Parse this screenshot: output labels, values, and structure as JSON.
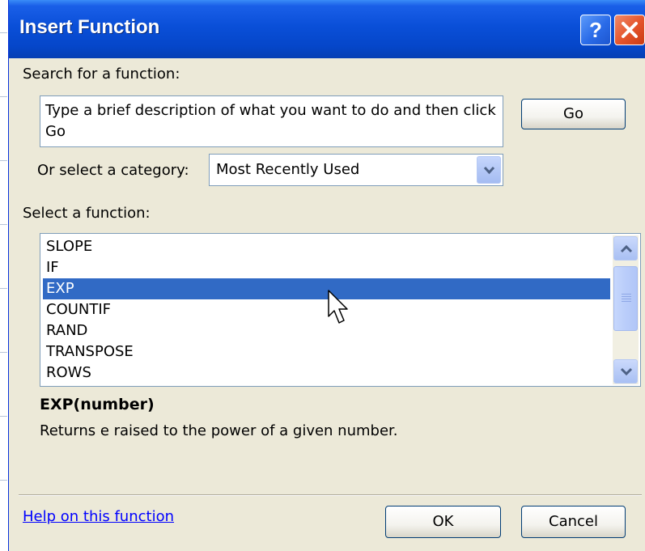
{
  "window": {
    "title": "Insert Function",
    "help_button": "?",
    "close_button": "close"
  },
  "search": {
    "label": "Search for a function:",
    "value": "Type a brief description of what you want to do and then click Go",
    "go_button": "Go"
  },
  "category": {
    "label": "Or select a category:",
    "selected": "Most Recently Used"
  },
  "functions": {
    "label": "Select a function:",
    "items": [
      "SLOPE",
      "IF",
      "EXP",
      "COUNTIF",
      "RAND",
      "TRANSPOSE",
      "ROWS"
    ],
    "selected_index": 2
  },
  "details": {
    "signature": "EXP(number)",
    "description": "Returns e raised to the power of a given number."
  },
  "footer": {
    "help_link": "Help on this function",
    "ok_button": "OK",
    "cancel_button": "Cancel"
  },
  "colors": {
    "titlebar": "#0a4fd8",
    "selection": "#316ac5",
    "dialog_bg": "#ece9d8",
    "link": "#0000ff"
  },
  "icons": [
    "help-icon",
    "close-icon",
    "chevron-down-icon",
    "scroll-up-icon",
    "scroll-down-icon",
    "mouse-cursor-icon"
  ]
}
